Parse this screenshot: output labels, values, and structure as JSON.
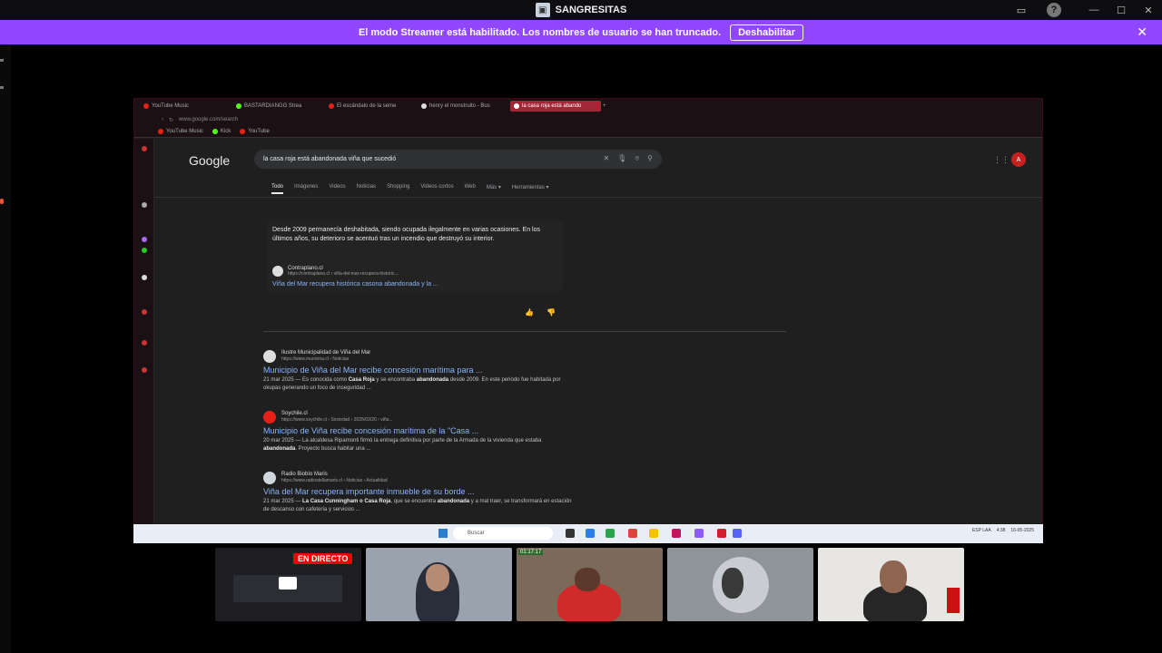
{
  "app": {
    "title": "SANGRESITAS"
  },
  "banner": {
    "message": "El modo Streamer está habilitado. Los nombres de usuario se han truncado.",
    "button": "Deshabilitar"
  },
  "browser": {
    "tabs": [
      {
        "label": "YouTube Music",
        "color": "#e62117"
      },
      {
        "label": "BASTARDIANGG Strea",
        "color": "#53fc18"
      },
      {
        "label": "El escándalo de la seme",
        "color": "#e62117"
      },
      {
        "label": "henry el monstruito - Bus",
        "color": "#dddddd"
      },
      {
        "label": "la casa roja está abando",
        "color": "#e62117"
      }
    ],
    "url": "www.google.com/search",
    "bookmarks": [
      {
        "label": "YouTube Music",
        "color": "#e62117"
      },
      {
        "label": "Kick",
        "color": "#53fc18"
      },
      {
        "label": "YouTube",
        "color": "#e62117"
      }
    ]
  },
  "google": {
    "logo": "Google",
    "query": "la casa roja está abandonada viña que sucedió",
    "avatar": "A",
    "tabs": [
      "Todo",
      "Imágenes",
      "Videos",
      "Noticias",
      "Shopping",
      "Videos cortos",
      "Web",
      "Más ▾",
      "Herramientas ▾"
    ],
    "snippet": {
      "text": "Desde 2009 permanecía deshabitada, siendo ocupada ilegalmente en varias ocasiones. En los últimos años, su deterioro se acentuó tras un incendio que destruyó su interior.",
      "source_name": "Contraplano.cl",
      "source_url": "https://contraplano.cl › viña-del-mar-recupera-historic...",
      "link": "Viña del Mar recupera histórica casona abandonada y la ..."
    },
    "results": [
      {
        "site": "Ilustre Municipalidad de Viña del Mar",
        "url": "https://www.munivina.cl › Noticias",
        "title": "Municipio de Viña del Mar recibe concesión marítima para ...",
        "desc_pre": "21 mar 2025 — Es conocida como ",
        "desc_b1": "Casa Roja",
        "desc_mid": " y se encontraba ",
        "desc_b2": "abandonada",
        "desc_post": " desde 2009. En este periodo fue habitada por okupas generando un foco de inseguridad ...",
        "color": "#dddddd"
      },
      {
        "site": "Soychile.cl",
        "url": "https://www.soychile.cl › Sociedad › 2025/03/20 › viña...",
        "title": "Municipio de Viña recibe concesión marítima de la \"Casa ...",
        "desc_pre": "20 mar 2025 — La alcaldesa Ripamonti firmó la entrega definitiva por parte de la Armada de la vivienda que estaba ",
        "desc_b1": "abandonada",
        "desc_mid": ". Proyecto busca habitar una ...",
        "desc_b2": "",
        "desc_post": "",
        "color": "#e62117"
      },
      {
        "site": "Radio Biobío Maris",
        "url": "https://www.radiostellamaris.cl › Noticias › Actualidad",
        "title": "Viña del Mar recupera importante inmueble de su borde ...",
        "desc_pre": "21 mar 2025 — ",
        "desc_b1": "La Casa Cunningham o Casa Roja",
        "desc_mid": ", que se encuentra ",
        "desc_b2": "abandonada",
        "desc_post": " y a mal traer, se transformará en estación de descanso con cafetería y servicios ...",
        "color": "#cfd8dc"
      }
    ]
  },
  "taskbar": {
    "search": "Buscar",
    "tray": [
      "ESP LAA",
      "4:38",
      "16-05-2025"
    ]
  },
  "cams": {
    "live_label": "EN DIRECTO",
    "timer": "01:17:17"
  }
}
